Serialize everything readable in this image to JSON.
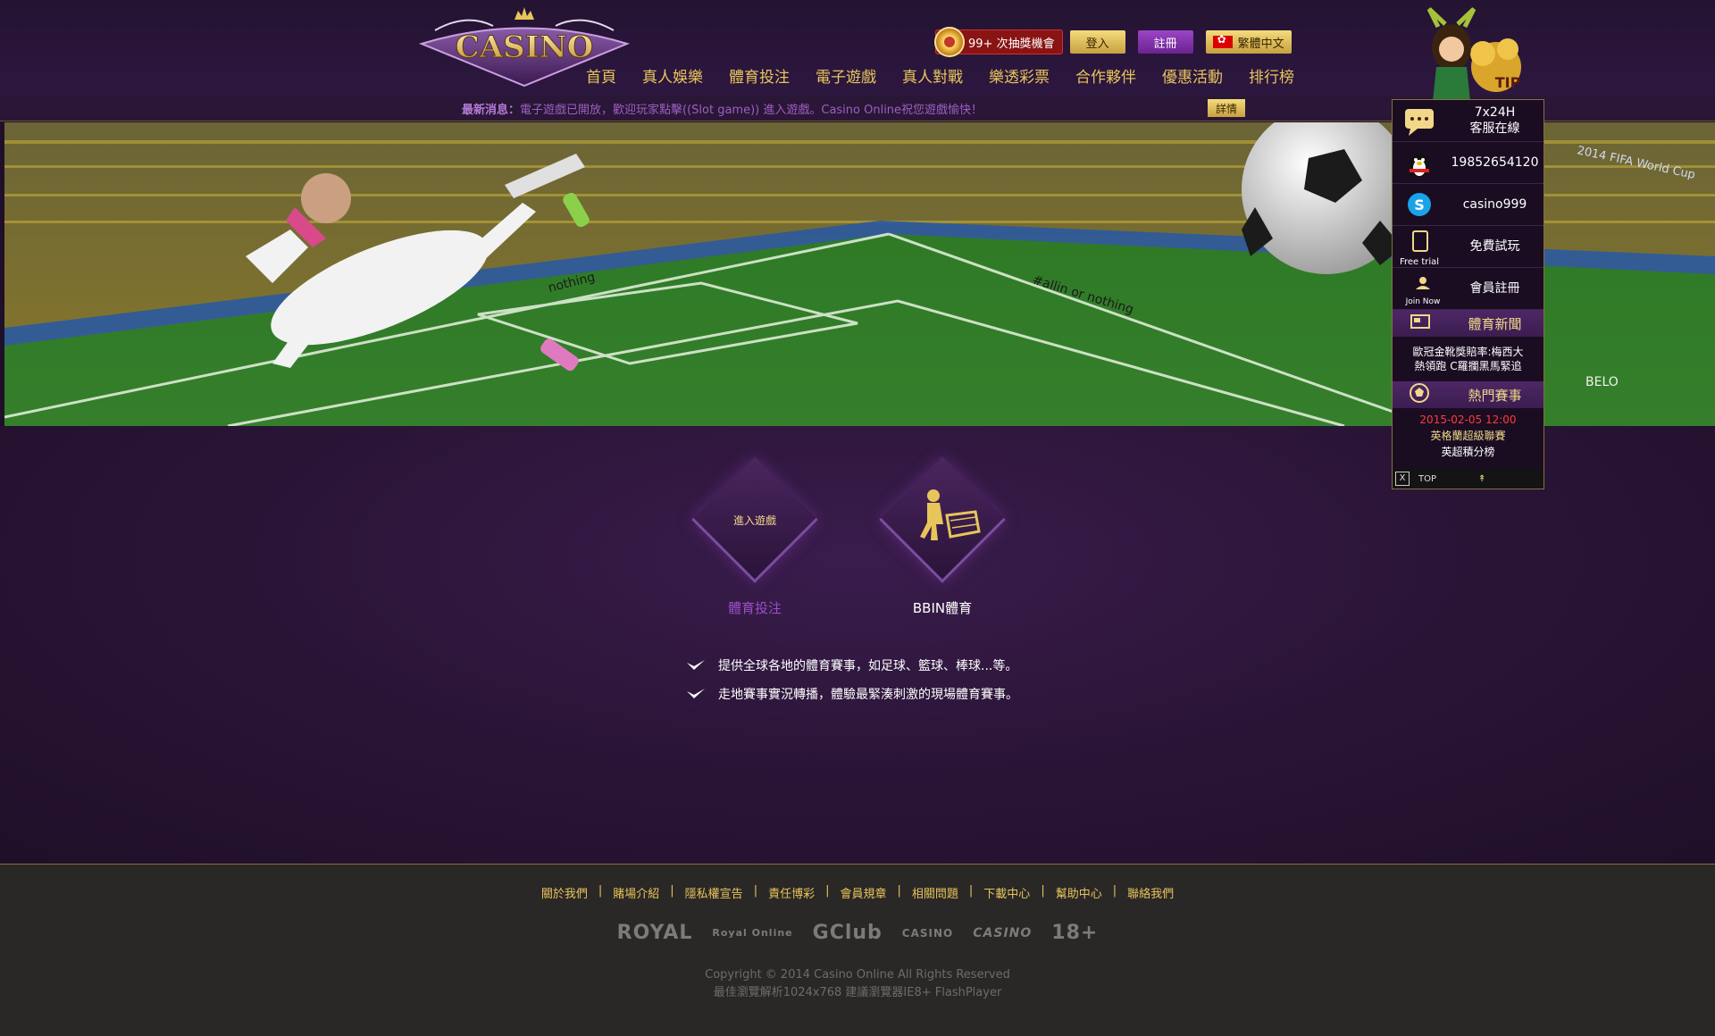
{
  "header": {
    "logo_text": "CASINO",
    "lottery": "99+ 次抽獎機會",
    "login": "登入",
    "register": "註冊",
    "language": "繁體中文",
    "nav": [
      "首頁",
      "真人娛樂",
      "體育投注",
      "電子遊戲",
      "真人對戰",
      "樂透彩票",
      "合作夥伴",
      "優惠活動",
      "排行榜"
    ]
  },
  "news": {
    "label": "最新消息：",
    "text": "電子遊戲已開放，歡迎玩家點擊((Slot game)) 進入遊戲。Casino Online祝您遊戲愉快！",
    "detail": "詳情"
  },
  "banner": {
    "stadium_text_1": "2014 FIFA World Cup",
    "stadium_text_2": "#allin or nothing",
    "stadium_text_3": "nothing",
    "stadium_text_4": "BELO"
  },
  "categories": [
    {
      "label": "體育投注",
      "badge": "進入遊戲",
      "color": "#9b4fc6"
    },
    {
      "label": "BBIN體育",
      "icon": "footballer-goal-icon",
      "color": "#ffffff"
    }
  ],
  "features": [
    "提供全球各地的體育賽事，如足球、籃球、棒球...等。",
    "走地賽事實況轉播，體驗最緊湊刺激的現場體育賽事。"
  ],
  "side": {
    "tip": "TIP",
    "support_line1": "7x24H",
    "support_line2": "客服在線",
    "qq": "19852654120",
    "skype": "casino999",
    "trial_caption": "Free trial",
    "trial": "免費試玩",
    "join_caption": "Join Now",
    "join": "會員註冊",
    "sports_news_title": "體育新聞",
    "sports_news_1": "歐冠金靴獎賠率:梅西大",
    "sports_news_2": "熱領跑 C羅攔黑馬緊追",
    "hot_title": "熱門賽事",
    "hot_date": "2015-02-05 12:00",
    "hot_league": "英格蘭超級聯賽",
    "hot_item": "英超積分榜",
    "close": "X",
    "top": "TOP",
    "top_arrow": "↟"
  },
  "footer": {
    "links": [
      "關於我們",
      "賭場介紹",
      "隱私權宣告",
      "責任博彩",
      "會員規章",
      "相關問題",
      "下載中心",
      "幫助中心",
      "聯絡我們"
    ],
    "partners": [
      "ROYAL",
      "Royal Online",
      "GClub",
      "CASINO",
      "CASINO",
      "18+"
    ],
    "copyright": "Copyright © 2014 Casino Online All Rights Reserved",
    "browser": "最佳瀏覽解析1024x768 建議瀏覽器IE8+ FlashPlayer"
  },
  "colors": {
    "gold": "#e7c55a",
    "purple": "#9b4fc6",
    "bg": "#1f0f28"
  }
}
